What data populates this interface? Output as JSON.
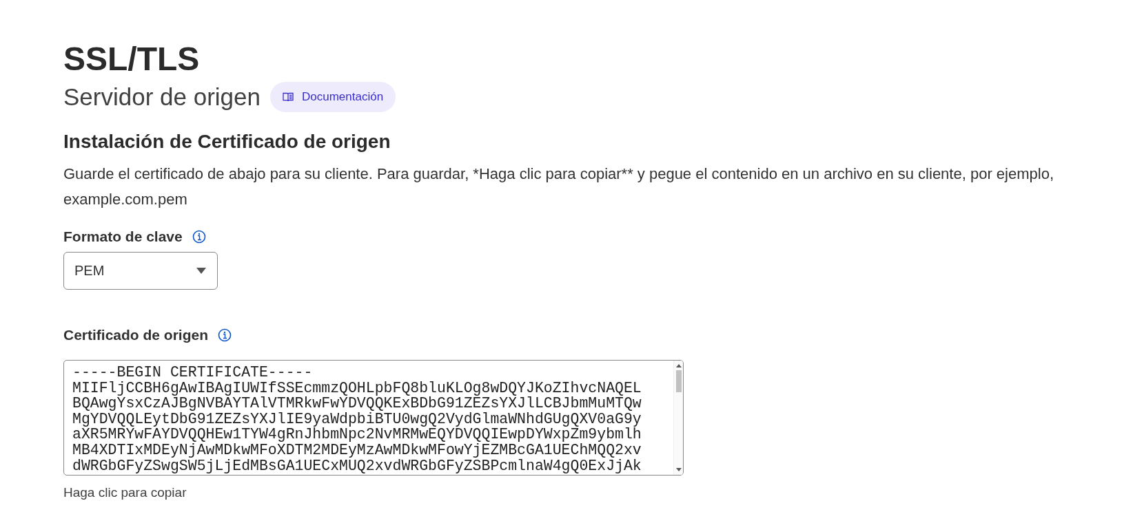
{
  "title": "SSL/TLS",
  "subtitle": "Servidor de origen",
  "docs_button": {
    "label": "Documentación"
  },
  "section": {
    "heading": "Instalación de Certificado de origen",
    "description": "Guarde el certificado de abajo para su cliente. Para guardar, *Haga clic para copiar** y pegue el contenido en un archivo en su cliente, por ejemplo, example.com.pem"
  },
  "key_format": {
    "label": "Formato de clave",
    "value": "PEM"
  },
  "certificate": {
    "label": "Certificado de origen",
    "lines": [
      "-----BEGIN CERTIFICATE-----",
      "MIIFljCCBH6gAwIBAgIUWIfSSEcmmzQOHLpbFQ8bluKLOg8wDQYJKoZIhvcNAQEL",
      "BQAwgYsxCzAJBgNVBAYTAlVTMRkwFwYDVQQKExBDbG91ZEZsYXJlLCBJbmMuMTQw",
      "MgYDVQQLEytDbG91ZEZsYXJlIE9yaWdpbiBTU0wgQ2VydGlmaWNhdGUgQXV0aG9y",
      "aXR5MRYwFAYDVQQHEw1TYW4gRnJhbmNpc2NvMRMwEQYDVQQIEwpDYWxpZm9ybmlh",
      "MB4XDTIxMDEyNjAwMDkwMFoXDTM2MDEyMzAwMDkwMFowYjEZMBcGA1UEChMQQ2xv",
      "dWRGbGFyZSwgSW5jLjEdMBsGA1UECxMUQ2xvdWRGbGFyZSBPcmlnaW4gQ0ExJjAk"
    ],
    "copy_hint": "Haga clic para copiar"
  }
}
